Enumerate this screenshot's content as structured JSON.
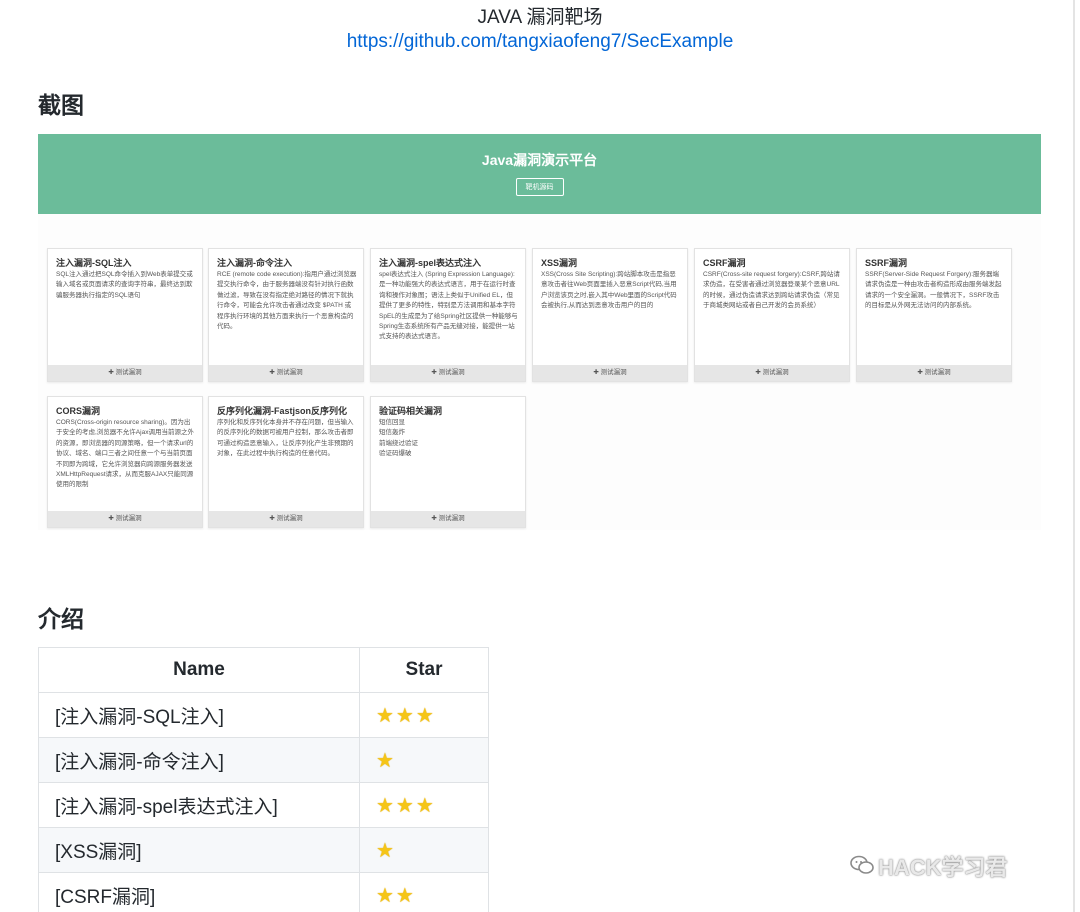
{
  "header": {
    "title": "JAVA 漏洞靶场",
    "link": "https://github.com/tangxiaofeng7/SecExample"
  },
  "sections": {
    "screenshot": "截图",
    "intro": "介绍"
  },
  "platform": {
    "title": "Java漏洞演示平台",
    "source_button": "靶机源码",
    "test_label": "✚ 测试漏洞",
    "cards": [
      {
        "title": "注入漏洞-SQL注入",
        "desc": "SQL注入通过把SQL命令插入到Web表单提交或输入域名或页面请求的查询字符串，最终达到欺骗服务器执行指定的SQL语句"
      },
      {
        "title": "注入漏洞-命令注入",
        "desc": "RCE (remote code execution):指用户通过浏览器提交执行命令，由于服务器端没有针对执行函数做过滤，导致在没有指定绝对路径的情况下就执行命令，可能会允许攻击者通过改变 $PATH 或程序执行环境的其他方面来执行一个恶意构造的代码。"
      },
      {
        "title": "注入漏洞-spel表达式注入",
        "desc": "spel表达式注入 (Spring Expression Language):是一种功能强大的表达式语言，用于在运行时查询和操作对象图；语法上类似于Unified EL，但提供了更多的特性，特别是方法调用和基本字符SpEL的生成是为了给Spring社区提供一种能够与Spring生态系统所有产品无缝对接，能提供一站式支持的表达式语言。"
      },
      {
        "title": "XSS漏洞",
        "desc": "XSS(Cross Site Scripting):跨站脚本攻击是指恶意攻击者往Web页面里插入恶意Script代码,当用户浏览该页之时,嵌入其中Web里面的Script代码会被执行,从而达到恶意攻击用户的目的"
      },
      {
        "title": "CSRF漏洞",
        "desc": "CSRF(Cross-site request forgery):CSRF,跨站请求伪造，在受害者通过浏览器登录某个恶意URL的时候，通过伪造请求达到跨站请求伪造（常见于商城类网站或者自己开发的会员系统）"
      },
      {
        "title": "SSRF漏洞",
        "desc": "SSRF(Server-Side Request Forgery):服务器端请求伪造是一种由攻击者构造形成由服务端发起请求的一个安全漏洞。一般情况下，SSRF攻击的目标是从外网无法访问的内部系统。"
      },
      {
        "title": "CORS漏洞",
        "desc": "CORS(Cross-origin resource sharing)。因为出于安全的考虑,浏览器不允许Ajax调用当前源之外的资源，即浏览器的同源策略，但一个请求url的协议、域名、端口三者之间任意一个与当前页面不同即为跨域，它允许浏览器向跨源服务器发送XMLHttpRequest请求，从而克服AJAX只能同源使用的限制"
      },
      {
        "title": "反序列化漏洞-Fastjson反序列化",
        "desc": "序列化和反序列化本身并不存在问题，但当输入的反序列化的数据可被用户控制，那么攻击者即可通过构造恶意输入，让反序列化产生非预期的对象，在此过程中执行构造的任意代码。"
      },
      {
        "title": "验证码相关漏洞",
        "desc": "短信回显\n短信轰炸\n前端绕过验证\n验证码爆破"
      }
    ]
  },
  "intro_table": {
    "headers": [
      "Name",
      "Star"
    ],
    "rows": [
      {
        "name": "[注入漏洞-SQL注入]",
        "stars": "★★★"
      },
      {
        "name": "[注入漏洞-命令注入]",
        "stars": "★"
      },
      {
        "name": "[注入漏洞-spel表达式注入]",
        "stars": "★★★"
      },
      {
        "name": "[XSS漏洞]",
        "stars": "★"
      },
      {
        "name": "[CSRF漏洞]",
        "stars": "★★"
      }
    ]
  },
  "watermark": {
    "icon": "wechat-icon",
    "text": "HACK学习君"
  }
}
